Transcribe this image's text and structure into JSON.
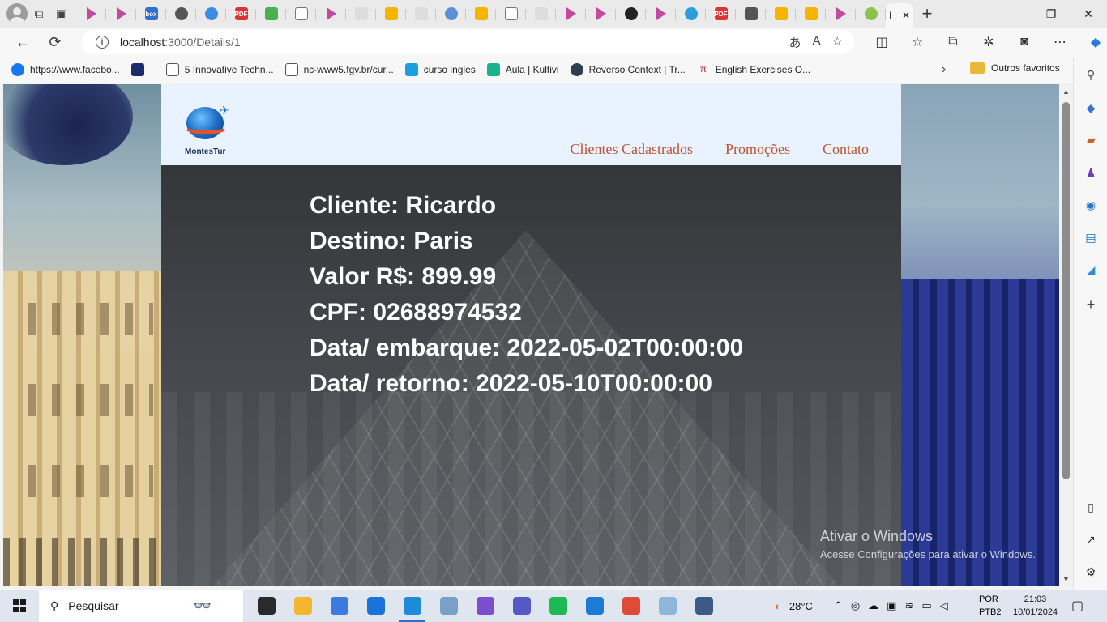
{
  "browser": {
    "url_host": "localhost",
    "url_path": ":3000/Details/1",
    "active_tab_label": "I",
    "window_controls": {
      "minimize": "—",
      "restore": "❐",
      "close": "✕"
    }
  },
  "bookmarks": [
    {
      "label": "https://www.facebo...",
      "color": "#1877f2"
    },
    {
      "label": "",
      "color": "#1c2a6e"
    },
    {
      "label": "5 Innovative Techn...",
      "color": "#ffffff"
    },
    {
      "label": "nc-www5.fgv.br/cur...",
      "color": "#ffffff"
    },
    {
      "label": "curso ingles",
      "color": "#1aa0e0"
    },
    {
      "label": "Aula | Kultivi",
      "color": "#17b38c"
    },
    {
      "label": "Reverso Context | Tr...",
      "color": "#2d3e50"
    },
    {
      "label": "English Exercises O...",
      "color": "#d04040"
    }
  ],
  "bookmarks_other": "Outros favoritos",
  "site": {
    "logo_text": "MontesTur",
    "nav": [
      "Clientes Cadastrados",
      "Promoções",
      "Contato"
    ],
    "details": [
      "Cliente: Ricardo",
      "Destino: Paris",
      "Valor R$: 899.99",
      "CPF: 02688974532",
      "Data/ embarque: 2022-05-02T00:00:00",
      "Data/ retorno: 2022-05-10T00:00:00"
    ]
  },
  "watermark": {
    "title": "Ativar o Windows",
    "subtitle": "Acesse Configurações para ativar o Windows."
  },
  "taskbar": {
    "search_placeholder": "Pesquisar",
    "temperature": "28°C",
    "lang_1": "POR",
    "lang_2": "PTB2",
    "time": "21:03",
    "date": "10/01/2024",
    "apps": [
      {
        "name": "task-view",
        "color": "#2a2a2a"
      },
      {
        "name": "file-explorer",
        "color": "#f2b630"
      },
      {
        "name": "microsoft-store",
        "color": "#3b7be0"
      },
      {
        "name": "mail",
        "color": "#1a73d8"
      },
      {
        "name": "edge",
        "color": "#1f8ad8"
      },
      {
        "name": "paint",
        "color": "#7aa0c8"
      },
      {
        "name": "visual-studio",
        "color": "#7c4dcc"
      },
      {
        "name": "teams",
        "color": "#5559c4"
      },
      {
        "name": "spotify",
        "color": "#1db954"
      },
      {
        "name": "vs-code",
        "color": "#1f7ad4"
      },
      {
        "name": "chrome",
        "color": "#dd4b39"
      },
      {
        "name": "notes",
        "color": "#8fb6d9"
      },
      {
        "name": "ssms",
        "color": "#3c5a86"
      }
    ]
  }
}
